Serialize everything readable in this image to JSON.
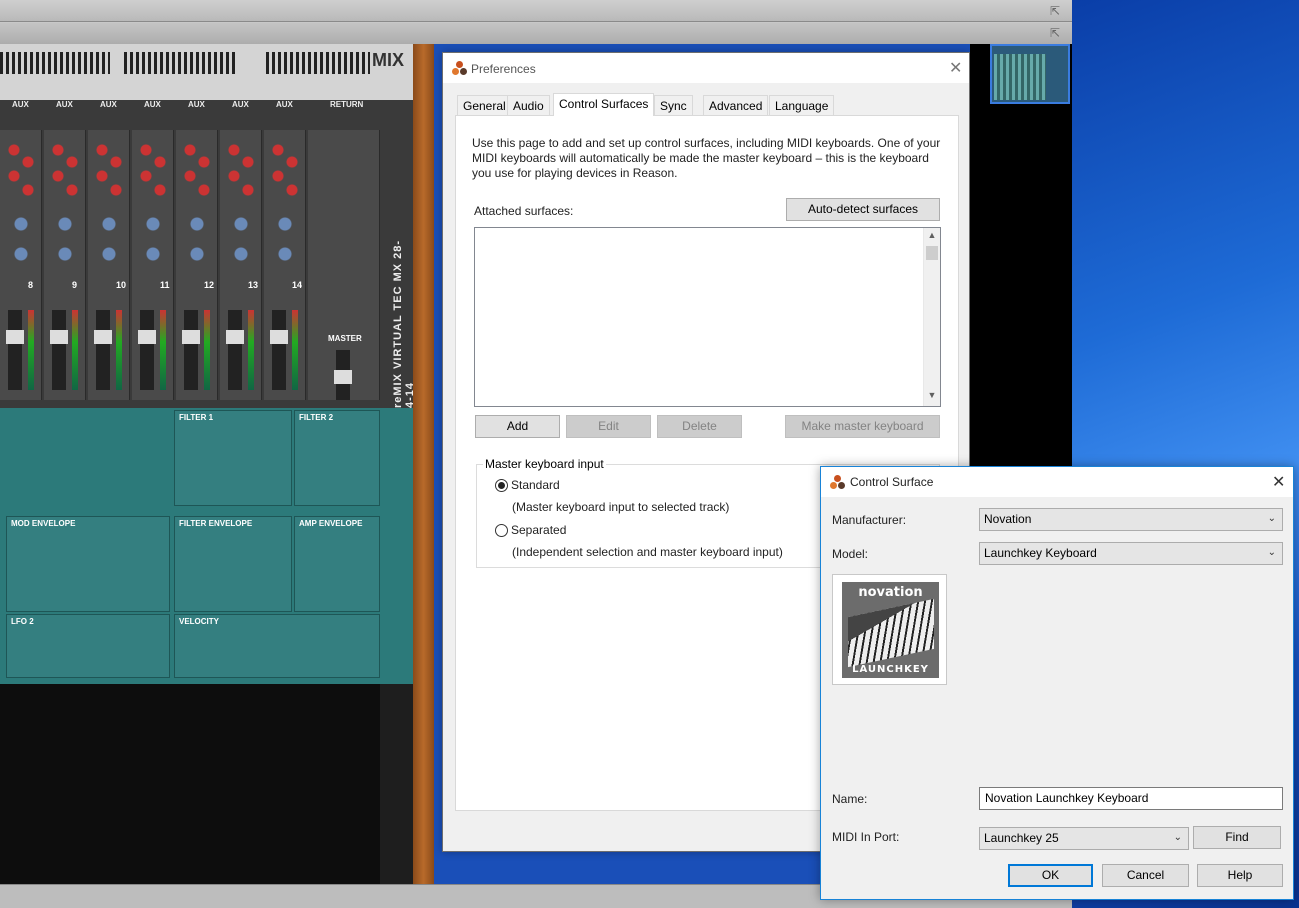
{
  "preferences": {
    "title": "Preferences",
    "tabs": [
      "General",
      "Audio",
      "Control Surfaces",
      "Sync",
      "Advanced",
      "Language"
    ],
    "active_tab": "Control Surfaces",
    "intro": "Use this page to add and set up control surfaces, including MIDI keyboards. One of your MIDI keyboards will automatically be made the master keyboard – this is the keyboard you use for playing devices in Reason.",
    "attached_label": "Attached surfaces:",
    "auto_detect_label": "Auto-detect surfaces",
    "add_label": "Add",
    "edit_label": "Edit",
    "delete_label": "Delete",
    "make_master_label": "Make master keyboard",
    "master_group_label": "Master keyboard input",
    "standard_label": "Standard",
    "standard_desc": "(Master keyboard input to selected track)",
    "separated_label": "Separated",
    "separated_desc": "(Independent selection and master keyboard input)"
  },
  "control_surface": {
    "title": "Control Surface",
    "manufacturer_label": "Manufacturer:",
    "manufacturer_value": "Novation",
    "model_label": "Model:",
    "model_value": "Launchkey Keyboard",
    "logo_brand": "novation",
    "logo_model": "LAUNCHKEY",
    "name_label": "Name:",
    "name_value": "Novation Launchkey Keyboard",
    "midi_label": "MIDI In Port:",
    "midi_value": "Launchkey 25",
    "find_label": "Find",
    "ok_label": "OK",
    "cancel_label": "Cancel",
    "help_label": "Help"
  },
  "rack": {
    "mix_label": "MIX",
    "brand_label": "reMIX VIRTUAL TEC MX 28-4-14",
    "aux_labels": [
      "AUX",
      "AUX",
      "AUX",
      "AUX",
      "AUX",
      "AUX",
      "AUX",
      "RETURN"
    ],
    "channel_numbers": [
      "8",
      "9",
      "10",
      "11",
      "12",
      "13",
      "14"
    ],
    "master_label": "MASTER",
    "synth_sections": [
      "FILTER 1",
      "FILTER 2",
      "MOD ENVELOPE",
      "FILTER ENVELOPE",
      "AMP ENVELOPE",
      "LFO 2",
      "VELOCITY"
    ]
  },
  "colors": {
    "accent": "#0078d7",
    "reason_teal": "#2c7a7a"
  }
}
